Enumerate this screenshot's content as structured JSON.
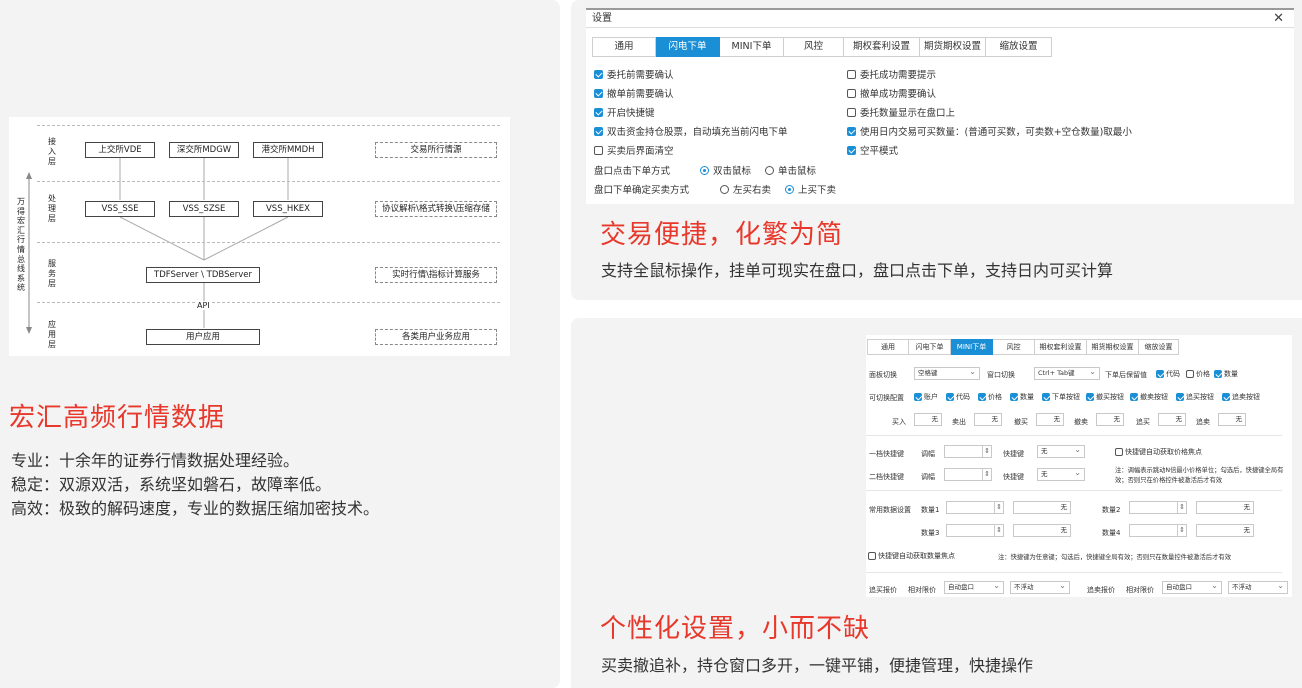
{
  "architecture": {
    "vertical_label": "万得宏汇行情总线系统",
    "layers": [
      "接入层",
      "处理层",
      "服务层",
      "应用层"
    ],
    "access_boxes": [
      "上交所VDE",
      "深交所MDGW",
      "港交所MMDH"
    ],
    "process_boxes": [
      "VSS_SSE",
      "VSS_SZSE",
      "VSS_HKEX"
    ],
    "server_box": "TDFServer \\ TDBServer",
    "api_label": "API",
    "app_box": "用户应用",
    "right_boxes": [
      "交易所行情源",
      "协议解析\\格式转换\\压缩存储",
      "实时行情\\指标计算服务",
      "各类用户业务应用"
    ]
  },
  "left_section": {
    "title": "宏汇高频行情数据",
    "lines": [
      "专业：十余年的证券行情数据处理经验。",
      "稳定：双源双活，系统坚如磐石，故障率低。",
      "高效：极致的解码速度，专业的数据压缩加密技术。"
    ]
  },
  "settings_window": {
    "title": "设置",
    "tabs": [
      "通用",
      "闪电下单",
      "MINI下单",
      "风控",
      "期权套利设置",
      "期货期权设置",
      "缩放设置"
    ],
    "active_tab": "闪电下单",
    "left_options": [
      {
        "label": "委托前需要确认",
        "checked": true
      },
      {
        "label": "撤单前需要确认",
        "checked": true
      },
      {
        "label": "开启快捷键",
        "checked": true
      },
      {
        "label": "双击资金持仓股票，自动填充当前闪电下单",
        "checked": true
      },
      {
        "label": "买卖后界面清空",
        "checked": false
      }
    ],
    "right_options": [
      {
        "label": "委托成功需要提示",
        "checked": false
      },
      {
        "label": "撤单成功需要确认",
        "checked": false
      },
      {
        "label": "委托数量显示在盘口上",
        "checked": false
      },
      {
        "label": "使用日内交易可买数量：(普通可买数，可卖数+空仓数量)取最小",
        "checked": true
      },
      {
        "label": "空平模式",
        "checked": true
      }
    ],
    "radio_rows": [
      {
        "label": "盘口点击下单方式",
        "options": [
          {
            "label": "双击鼠标",
            "selected": true
          },
          {
            "label": "单击鼠标",
            "selected": false
          }
        ]
      },
      {
        "label": "盘口下单确定买卖方式",
        "options": [
          {
            "label": "左买右卖",
            "selected": false
          },
          {
            "label": "上买下卖",
            "selected": true
          }
        ]
      }
    ]
  },
  "right_top_section": {
    "title": "交易便捷，化繁为简",
    "body": "支持全鼠标操作，挂单可现实在盘口，盘口点击下单，支持日内可买计算"
  },
  "mini_window": {
    "tabs": [
      "通用",
      "闪电下单",
      "MINI下单",
      "风控",
      "期权套利设置",
      "期货期权设置",
      "缩放设置"
    ],
    "active_tab": "MINI下单",
    "panel_switch_label": "面板切换",
    "panel_switch_value": "空格键",
    "window_switch_label": "窗口切换",
    "window_switch_value": "Ctrl+ Tab键",
    "keep_label": "下单后保留值",
    "keep_options": [
      {
        "label": "代码",
        "checked": true
      },
      {
        "label": "价格",
        "checked": false
      },
      {
        "label": "数量",
        "checked": true
      }
    ],
    "visible_label": "可切换配置",
    "visible_options": [
      {
        "label": "账户",
        "checked": true
      },
      {
        "label": "代码",
        "checked": true
      },
      {
        "label": "价格",
        "checked": true
      },
      {
        "label": "数量",
        "checked": true
      },
      {
        "label": "下单按钮",
        "checked": true
      },
      {
        "label": "撤买按钮",
        "checked": true
      },
      {
        "label": "撤卖按钮",
        "checked": true
      },
      {
        "label": "追买按钮",
        "checked": true
      },
      {
        "label": "追卖按钮",
        "checked": true
      }
    ],
    "quick_fields": [
      {
        "label": "买入",
        "value": "无"
      },
      {
        "label": "卖出",
        "value": "无"
      },
      {
        "label": "撤买",
        "value": "无"
      },
      {
        "label": "撤卖",
        "value": "无"
      },
      {
        "label": "追买",
        "value": "无"
      },
      {
        "label": "追卖",
        "value": "无"
      }
    ],
    "level1_label": "一档快捷键",
    "level2_label": "二档快捷键",
    "adjust_label": "调幅",
    "shortcut_label": "快捷键",
    "shortcut_value": "无",
    "auto_cb_label": "快捷键自动获取价格焦点",
    "note1": "注：调幅表示跳动N倍最小价格单位；勾选后，快捷键全局有效；否则只在价格控件被激活后才有效",
    "common_label": "常用数据设置",
    "qty_labels": [
      "数量1",
      "数量2",
      "数量3",
      "数量4"
    ],
    "qty_value": "无",
    "auto_qty_label": "快捷键自动获取数量焦点",
    "note2": "注：快捷键为任意键；勾选后，快捷键全局有效；否则只在数量控件被激活后才有效",
    "chase_buy_label": "追买报价",
    "chase_sell_label": "追卖报价",
    "relative_label": "相对限价",
    "auto_value": "自动盘口",
    "float_value": "不浮动"
  },
  "right_bottom_section": {
    "title": "个性化设置，小而不缺",
    "body": "买卖撤追补，持仓窗口多开，一键平铺，便捷管理，快捷操作"
  }
}
